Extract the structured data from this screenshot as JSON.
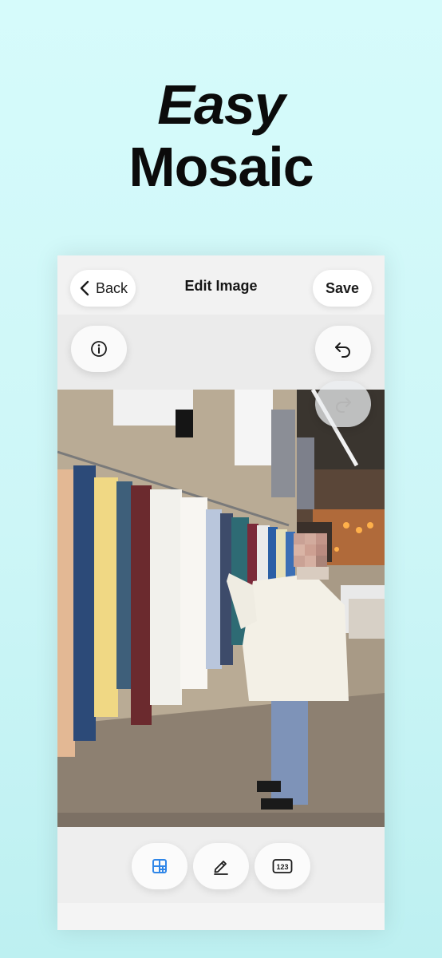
{
  "headline": {
    "line1": "Easy",
    "line2": "Mosaic"
  },
  "nav": {
    "back_label": "Back",
    "title": "Edit Image",
    "save_label": "Save"
  },
  "actions": {
    "info_icon": "info-icon",
    "undo_icon": "undo-icon",
    "redo_icon": "redo-icon"
  },
  "tools": [
    {
      "icon": "mosaic-grid-icon",
      "active": true
    },
    {
      "icon": "pencil-icon",
      "active": false
    },
    {
      "icon": "number-123-icon",
      "active": false
    }
  ],
  "tool_badge_text": "123",
  "colors": {
    "accent": "#2f86e8",
    "background": "#d2f8f8"
  }
}
